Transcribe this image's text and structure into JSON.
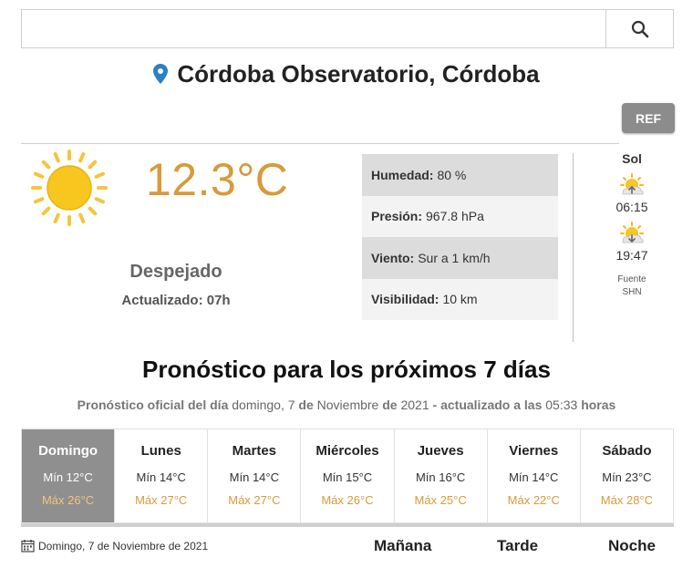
{
  "search": {
    "placeholder": "",
    "value": ""
  },
  "location": {
    "name": "Córdoba Observatorio, Córdoba"
  },
  "ref_button": "REF",
  "current": {
    "temperature": "12.3°C",
    "condition": "Despejado",
    "updated": "Actualizado: 07h"
  },
  "stats": [
    {
      "label": "Humedad:",
      "value": "80 %"
    },
    {
      "label": "Presión:",
      "value": "967.8 hPa"
    },
    {
      "label": "Viento:",
      "value": "Sur a 1 km/h"
    },
    {
      "label": "Visibilidad:",
      "value": "10 km"
    }
  ],
  "sol": {
    "title": "Sol",
    "sunrise": "06:15",
    "sunset": "19:47",
    "fuente_label": "Fuente",
    "fuente_source": "SHN"
  },
  "forecast": {
    "title": "Pronóstico para los próximos 7 días",
    "sub_prefix": "Pronóstico oficial del día",
    "sub_day": "domingo, 7",
    "sub_de1": "de",
    "sub_month": "Noviembre",
    "sub_de2": "de",
    "sub_year": "2021",
    "sub_dash": "-",
    "sub_updated": "actualizado a las",
    "sub_time": "05:33",
    "sub_horas": "horas",
    "days": [
      {
        "name": "Domingo",
        "min": "Mín 12°C",
        "max": "Máx 26°C"
      },
      {
        "name": "Lunes",
        "min": "Mín 14°C",
        "max": "Máx 27°C"
      },
      {
        "name": "Martes",
        "min": "Mín 14°C",
        "max": "Máx 27°C"
      },
      {
        "name": "Miércoles",
        "min": "Mín 15°C",
        "max": "Máx 26°C"
      },
      {
        "name": "Jueves",
        "min": "Mín 16°C",
        "max": "Máx 25°C"
      },
      {
        "name": "Viernes",
        "min": "Mín 14°C",
        "max": "Máx 22°C"
      },
      {
        "name": "Sábado",
        "min": "Mín 23°C",
        "max": "Máx 28°C"
      }
    ]
  },
  "day_detail": {
    "date": "Domingo, 7 de Noviembre de 2021",
    "periods": [
      "Mañana",
      "Tarde",
      "Noche"
    ]
  },
  "colors": {
    "accent": "#d89a3b",
    "pin": "#2a7fc9",
    "active_day": "#8f8f8f",
    "ref_button": "#8c8c8c"
  },
  "icons": {
    "search": "search-icon",
    "pin": "map-pin-icon",
    "weather": "sun-icon",
    "sunrise": "sunrise-icon",
    "sunset": "sunset-icon",
    "calendar": "calendar-icon"
  }
}
